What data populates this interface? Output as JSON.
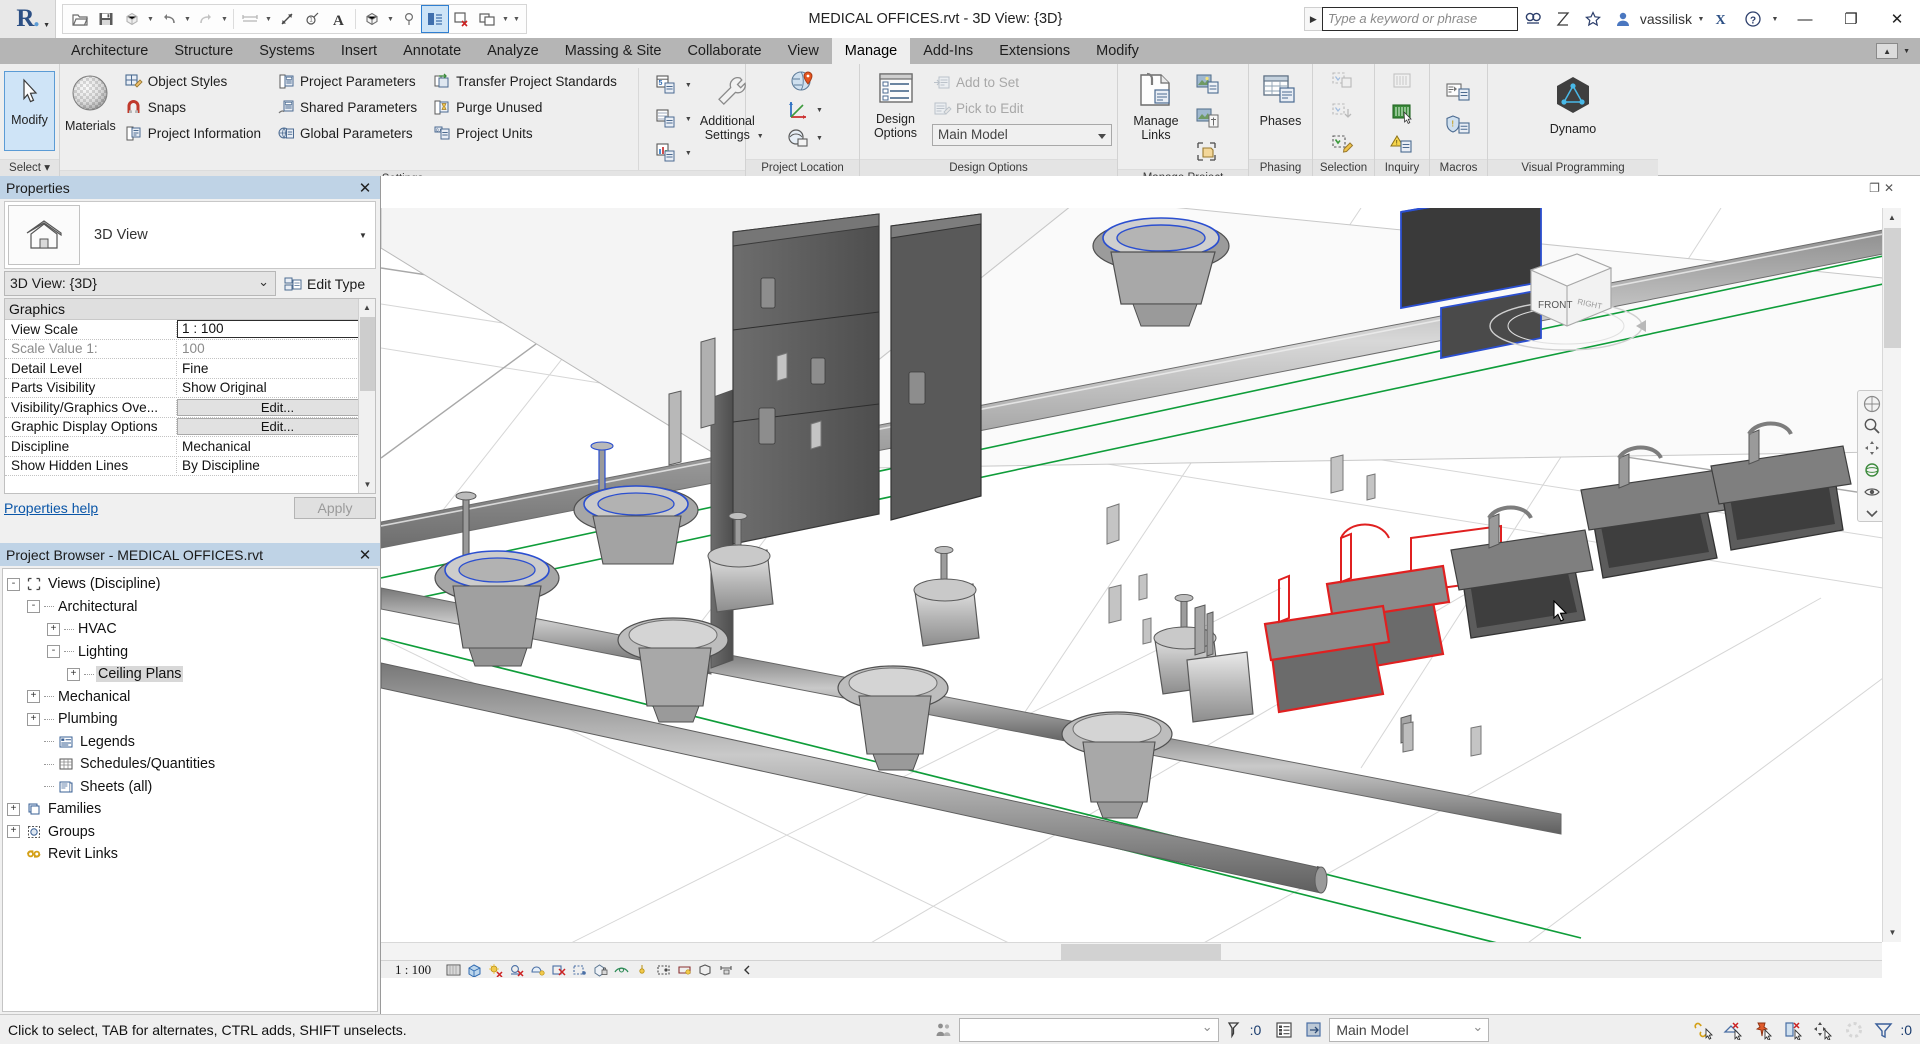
{
  "titlebar": {
    "document_title": "MEDICAL OFFICES.rvt - 3D View: {3D}",
    "search_placeholder": "Type a keyword or phrase",
    "username": "vassilisk",
    "quick_access": [
      {
        "name": "open-icon",
        "label": "Open"
      },
      {
        "name": "save-icon",
        "label": "Save"
      },
      {
        "name": "export-icon",
        "label": "Export"
      },
      {
        "name": "undo-icon",
        "label": "Undo"
      },
      {
        "name": "redo-icon",
        "label": "Redo"
      },
      {
        "name": "measure-icon",
        "label": "Measure"
      },
      {
        "name": "aligned-dimension-icon",
        "label": "Aligned Dimension"
      },
      {
        "name": "tag-icon",
        "label": "Tag by Category"
      },
      {
        "name": "text-icon",
        "label": "Text"
      },
      {
        "name": "default-3d-view-icon",
        "label": "Default 3D View"
      },
      {
        "name": "section-icon",
        "label": "Section"
      },
      {
        "name": "thin-lines-icon",
        "label": "Thin Lines"
      },
      {
        "name": "close-hidden-windows-icon",
        "label": "Close Hidden Windows"
      },
      {
        "name": "switch-windows-icon",
        "label": "Switch Windows"
      }
    ],
    "window_buttons": {
      "minimize": "—",
      "maximize": "❐",
      "close": "✕"
    }
  },
  "tabs": {
    "items": [
      {
        "label": "Architecture",
        "selected": false
      },
      {
        "label": "Structure",
        "selected": false
      },
      {
        "label": "Systems",
        "selected": false
      },
      {
        "label": "Insert",
        "selected": false
      },
      {
        "label": "Annotate",
        "selected": false
      },
      {
        "label": "Analyze",
        "selected": false
      },
      {
        "label": "Massing & Site",
        "selected": false
      },
      {
        "label": "Collaborate",
        "selected": false
      },
      {
        "label": "View",
        "selected": false
      },
      {
        "label": "Manage",
        "selected": true
      },
      {
        "label": "Add-Ins",
        "selected": false
      },
      {
        "label": "Extensions",
        "selected": false
      },
      {
        "label": "Modify",
        "selected": false
      }
    ]
  },
  "ribbon": {
    "select": {
      "panel_title": "Select ▾",
      "modify_label": "Modify"
    },
    "settings": {
      "panel_title": "Settings",
      "materials_label": "Materials",
      "items": [
        {
          "label": "Object Styles",
          "icon": "object-styles-icon"
        },
        {
          "label": "Snaps",
          "icon": "snaps-icon"
        },
        {
          "label": "Project Information",
          "icon": "project-information-icon"
        },
        {
          "label": "Project Parameters",
          "icon": "project-parameters-icon"
        },
        {
          "label": "Shared Parameters",
          "icon": "shared-parameters-icon"
        },
        {
          "label": "Global Parameters",
          "icon": "global-parameters-icon"
        },
        {
          "label": "Transfer Project Standards",
          "icon": "transfer-project-standards-icon"
        },
        {
          "label": "Purge Unused",
          "icon": "purge-unused-icon"
        },
        {
          "label": "Project Units",
          "icon": "project-units-icon"
        }
      ],
      "stack_icons": [
        {
          "name": "shared-coordinates-icon"
        },
        {
          "name": "fill-patterns-icon"
        },
        {
          "name": "analysis-display-styles-icon"
        }
      ],
      "additional_settings_label": "Additional\nSettings",
      "additional_settings_line1": "Additional",
      "additional_settings_line2": "Settings"
    },
    "project_location": {
      "panel_title": "Project Location",
      "icons": [
        {
          "name": "location-icon"
        },
        {
          "name": "coordinates-icon"
        },
        {
          "name": "position-icon"
        }
      ]
    },
    "design_options": {
      "panel_title": "Design Options",
      "design_label_line1": "Design",
      "design_label_line2": "Options",
      "add_to_set_label": "Add to Set",
      "pick_to_edit_label": "Pick to Edit",
      "active_option": "Main Model"
    },
    "manage_project": {
      "panel_title": "Manage Project",
      "manage_links_line1": "Manage",
      "manage_links_line2": "Links",
      "icons": [
        {
          "name": "decal-types-icon"
        },
        {
          "name": "manage-images-icon"
        },
        {
          "name": "starting-view-icon"
        }
      ]
    },
    "phasing": {
      "panel_title": "Phasing",
      "phases_label": "Phases"
    },
    "selection": {
      "panel_title": "Selection",
      "icons": [
        {
          "name": "save-selection-icon"
        },
        {
          "name": "load-selection-icon"
        },
        {
          "name": "edit-selection-icon"
        }
      ]
    },
    "inquiry": {
      "panel_title": "Inquiry",
      "icons": [
        {
          "name": "ids-of-selection-icon"
        },
        {
          "name": "select-by-id-icon"
        },
        {
          "name": "warnings-icon"
        }
      ]
    },
    "macros": {
      "panel_title": "Macros",
      "icons": [
        {
          "name": "macro-manager-icon"
        },
        {
          "name": "macro-security-icon"
        }
      ]
    },
    "visual_programming": {
      "panel_title": "Visual Programming",
      "dynamo_label": "Dynamo"
    }
  },
  "properties": {
    "panel_title": "Properties",
    "family_label": "3D View",
    "type_value": "3D View: {3D}",
    "edit_type_label": "Edit Type",
    "section_header": "Graphics",
    "rows": [
      {
        "key": "View Scale",
        "value": "1 : 100",
        "style": "boxed"
      },
      {
        "key": "Scale Value    1:",
        "value": "100",
        "style": "gray"
      },
      {
        "key": "Detail Level",
        "value": "Fine",
        "style": "plain"
      },
      {
        "key": "Parts Visibility",
        "value": "Show Original",
        "style": "plain"
      },
      {
        "key": "Visibility/Graphics Ove...",
        "value": "Edit...",
        "style": "button"
      },
      {
        "key": "Graphic Display Options",
        "value": "Edit...",
        "style": "button"
      },
      {
        "key": "Discipline",
        "value": "Mechanical",
        "style": "plain"
      },
      {
        "key": "Show Hidden Lines",
        "value": "By Discipline",
        "style": "plain"
      }
    ],
    "help_link": "Properties help",
    "apply_label": "Apply"
  },
  "project_browser": {
    "panel_title": "Project Browser - MEDICAL OFFICES.rvt",
    "nodes": [
      {
        "label": "Views (Discipline)",
        "depth": 0,
        "expander": "-",
        "icon": "views-icon",
        "selected": false
      },
      {
        "label": "Architectural",
        "depth": 1,
        "expander": "-",
        "icon": "",
        "selected": false
      },
      {
        "label": "HVAC",
        "depth": 2,
        "expander": "+",
        "icon": "",
        "selected": false
      },
      {
        "label": "Lighting",
        "depth": 2,
        "expander": "-",
        "icon": "",
        "selected": false
      },
      {
        "label": "Ceiling Plans",
        "depth": 3,
        "expander": "+",
        "icon": "",
        "selected": true
      },
      {
        "label": "Mechanical",
        "depth": 1,
        "expander": "+",
        "icon": "",
        "selected": false
      },
      {
        "label": "Plumbing",
        "depth": 1,
        "expander": "+",
        "icon": "",
        "selected": false
      },
      {
        "label": "Legends",
        "depth": 1,
        "expander": "",
        "icon": "legends-icon",
        "selected": false
      },
      {
        "label": "Schedules/Quantities",
        "depth": 1,
        "expander": "",
        "icon": "schedules-icon",
        "selected": false
      },
      {
        "label": "Sheets (all)",
        "depth": 1,
        "expander": "",
        "icon": "sheets-icon",
        "selected": false
      },
      {
        "label": "Families",
        "depth": 0,
        "expander": "+",
        "icon": "families-icon",
        "selected": false
      },
      {
        "label": "Groups",
        "depth": 0,
        "expander": "+",
        "icon": "groups-icon",
        "selected": false
      },
      {
        "label": "Revit Links",
        "depth": 0,
        "expander": "",
        "icon": "revit-links-icon",
        "selected": false
      }
    ]
  },
  "view": {
    "navcube_front_label": "FRONT",
    "view_control_scale": "1 : 100",
    "view_control_icons": [
      {
        "name": "detail-level-fine-icon"
      },
      {
        "name": "visual-style-shaded-icon"
      },
      {
        "name": "sun-path-off-icon"
      },
      {
        "name": "shadows-off-icon"
      },
      {
        "name": "rendering-dialog-icon"
      },
      {
        "name": "crop-view-off-icon"
      },
      {
        "name": "show-crop-region-icon"
      },
      {
        "name": "lock-3d-view-icon"
      },
      {
        "name": "temporary-hide-isolate-icon"
      },
      {
        "name": "reveal-hidden-elements-icon"
      },
      {
        "name": "temporary-view-properties-icon"
      },
      {
        "name": "analytical-model-icon"
      },
      {
        "name": "constraints-icon"
      },
      {
        "name": "show-panel-icon"
      }
    ]
  },
  "statusbar": {
    "message": "Click to select, TAB for alternates, CTRL adds, SHIFT unselects.",
    "model_filter_value": "",
    "warning_count": ":0",
    "design_option_value": "Main Model",
    "filter_count": ":0",
    "right_icons": [
      {
        "name": "select-links-icon"
      },
      {
        "name": "select-underlay-elements-icon"
      },
      {
        "name": "select-pinned-elements-icon"
      },
      {
        "name": "select-elements-by-face-icon"
      },
      {
        "name": "drag-elements-on-selection-icon"
      },
      {
        "name": "progress-ring-icon"
      },
      {
        "name": "filter-icon"
      }
    ]
  }
}
